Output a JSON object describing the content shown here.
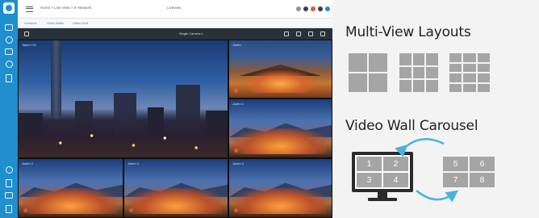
{
  "app": {
    "breadcrumb": "Home > Live View > AI Network",
    "center_title": "Liveview",
    "tabs": [
      "Liveview",
      "Video Walls",
      "Video Grid"
    ],
    "viewbar_label": "Single Camera 1",
    "cells": [
      "Taipei 101",
      "Jiufen",
      "Jiufen 1",
      "Jiufen 2",
      "Jiufen 3",
      "Jiufen 4"
    ]
  },
  "feature": {
    "multiview_title": "Multi-View Layouts",
    "carousel_title": "Video Wall Carousel",
    "monitor_numbers": [
      "1",
      "2",
      "3",
      "4"
    ],
    "wall_numbers": [
      "5",
      "6",
      "7",
      "8"
    ]
  },
  "colors": {
    "sidebar": "#1f8fd0",
    "tile_grey": "#a5a5a5",
    "arrow_blue": "#4ab0e3"
  }
}
